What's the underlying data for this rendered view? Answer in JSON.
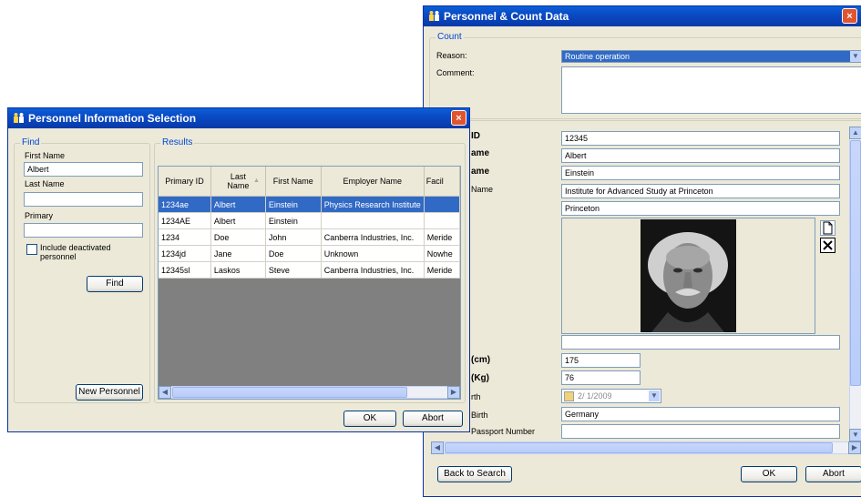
{
  "personnel_count_window": {
    "title": "Personnel & Count Data",
    "close_glyph": "×",
    "count_group": {
      "label": "Count",
      "reason_label": "Reason:",
      "reason_value": "Routine operation",
      "comment_label": "Comment:",
      "comment_value": ""
    },
    "fields": {
      "id_label": "ID",
      "id_value": "12345",
      "first_name_label": "ame",
      "first_name_value": "Albert",
      "last_name_label": "ame",
      "last_name_value": "Einstein",
      "employer_label": "Name",
      "employer_value": "Institute for Advanced Study at Princeton",
      "facility_value": "Princeton",
      "photo_caption_value": "",
      "height_label": "(cm)",
      "height_value": "175",
      "weight_label": "(Kg)",
      "weight_value": "76",
      "dob_label": "rth",
      "dob_value": "2/  1/2009",
      "birthplace_label": "Birth",
      "birthplace_value": "Germany",
      "passport_label": "Passport Number",
      "passport_value": ""
    },
    "photo_buttons": {
      "new_icon": "new-document-icon",
      "delete_icon": "delete-x-icon"
    },
    "buttons": {
      "back": "Back to Search",
      "ok": "OK",
      "abort": "Abort"
    }
  },
  "selection_window": {
    "title": "Personnel Information Selection",
    "close_glyph": "×",
    "find_group": {
      "label": "Find",
      "first_name_label": "First Name",
      "first_name_value": "Albert",
      "last_name_label": "Last Name",
      "last_name_value": "",
      "primary_label": "Primary",
      "primary_value": "",
      "include_deactivated_label": "Include deactivated personnel",
      "include_deactivated_checked": false,
      "find_button": "Find",
      "new_personnel_button": "New Personnel"
    },
    "results_group": {
      "label": "Results",
      "columns": [
        "Primary ID",
        "Last Name",
        "First Name",
        "Employer Name",
        "Facil"
      ],
      "rows": [
        [
          "1234ae",
          "Albert",
          "Einstein",
          "Physics Research Institute",
          ""
        ],
        [
          "1234AE",
          "Albert",
          "Einstein",
          "",
          ""
        ],
        [
          "1234",
          "Doe",
          "John",
          "Canberra Industries, Inc.",
          "Meride"
        ],
        [
          "1234jd",
          "Jane",
          "Doe",
          "Unknown",
          "Nowhe"
        ],
        [
          "12345sl",
          "Laskos",
          "Steve",
          "Canberra Industries, Inc.",
          "Meride"
        ]
      ],
      "selected_row": 0
    },
    "buttons": {
      "ok": "OK",
      "abort": "Abort"
    }
  },
  "colors": {
    "titlebar": "#0a4bc4",
    "selection": "#316ac5",
    "group_label": "#0046d5",
    "grid_empty": "#808080",
    "dialog_bg": "#ece9d8"
  }
}
